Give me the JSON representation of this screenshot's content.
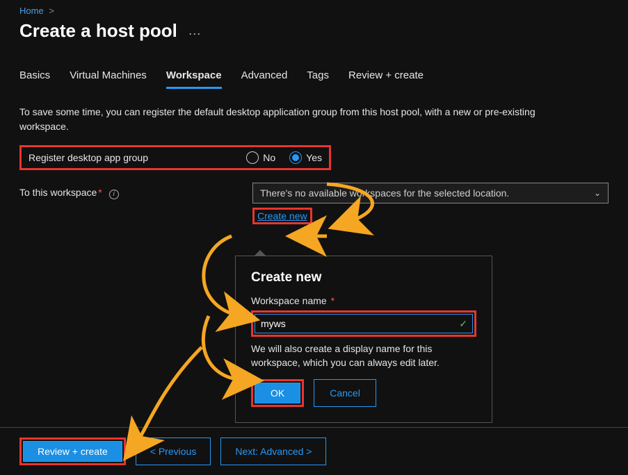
{
  "breadcrumb": {
    "home": "Home"
  },
  "page": {
    "title": "Create a host pool"
  },
  "tabs": {
    "basics": "Basics",
    "vms": "Virtual Machines",
    "workspace": "Workspace",
    "advanced": "Advanced",
    "tags": "Tags",
    "review": "Review + create"
  },
  "intro": "To save some time, you can register the default desktop application group from this host pool, with a new or pre-existing workspace.",
  "form": {
    "register_label": "Register desktop app group",
    "no": "No",
    "yes": "Yes",
    "to_workspace_label": "To this workspace",
    "dropdown_text": "There's no available workspaces for the selected location.",
    "create_new_link": "Create new"
  },
  "popup": {
    "title": "Create new",
    "name_label": "Workspace name",
    "name_value": "myws",
    "helper": "We will also create a display name for this workspace, which you can always edit later.",
    "ok": "OK",
    "cancel": "Cancel"
  },
  "footer": {
    "review": "Review + create",
    "previous": "< Previous",
    "next": "Next: Advanced >"
  }
}
